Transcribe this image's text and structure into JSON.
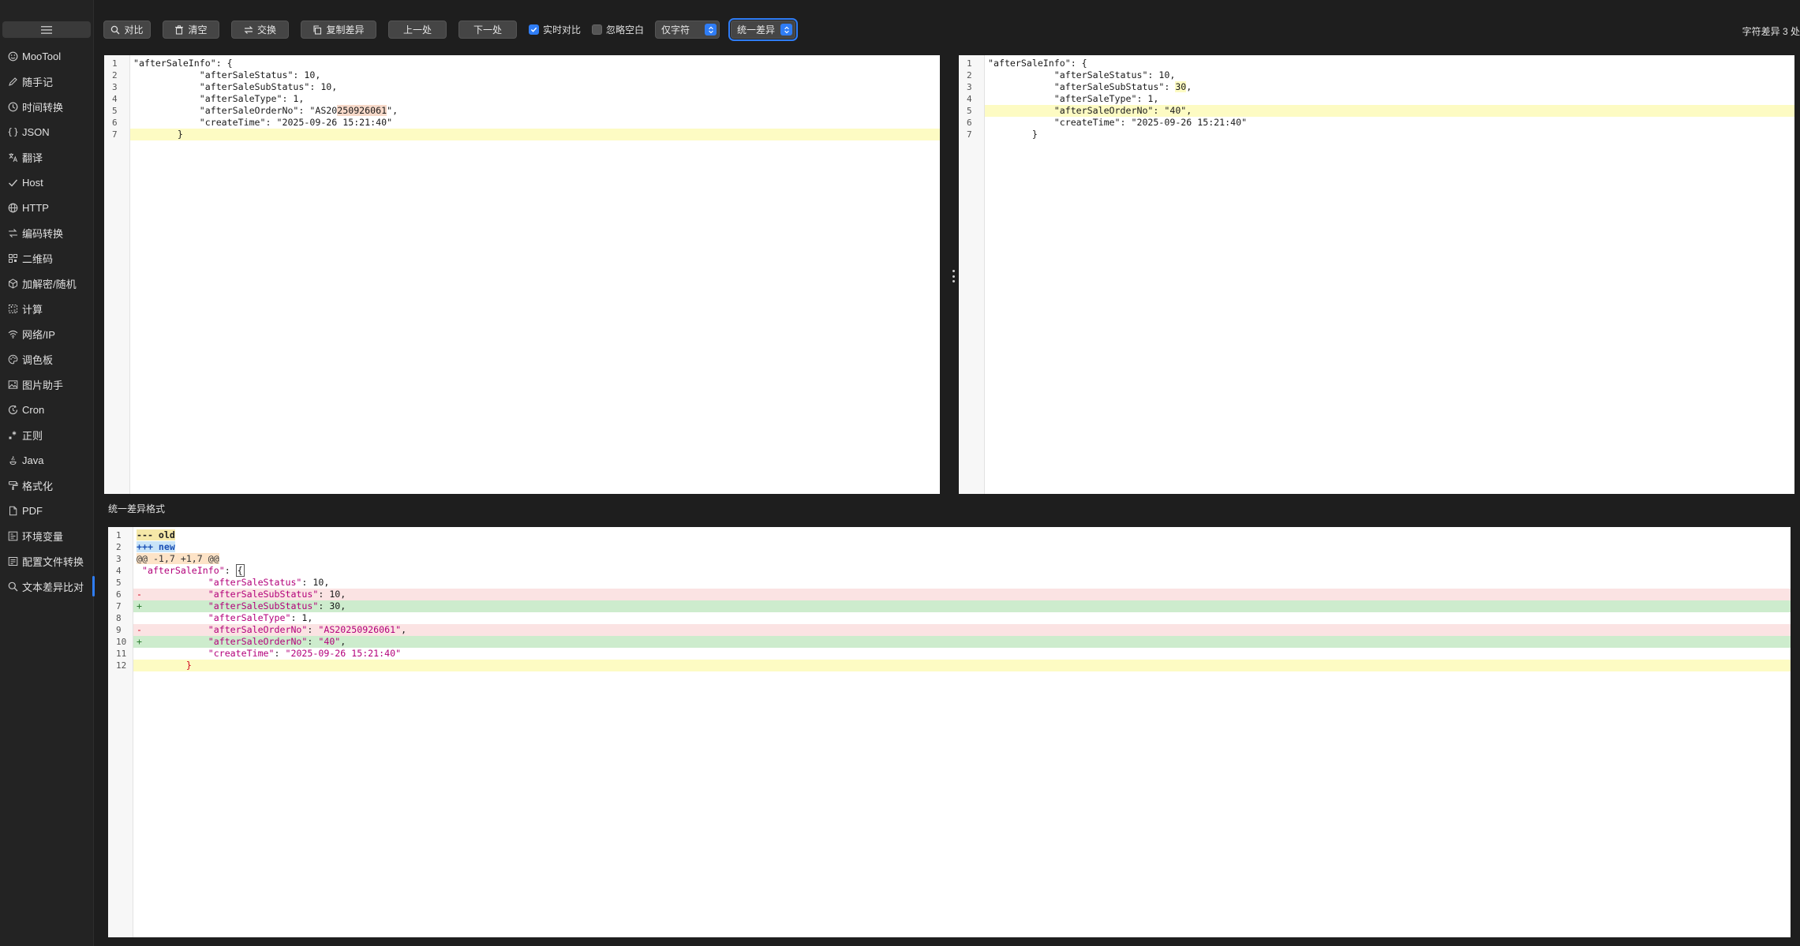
{
  "window": {
    "title": ""
  },
  "sidebar": {
    "items": [
      {
        "label": "MooTool",
        "icon": "smile-icon"
      },
      {
        "label": "随手记",
        "icon": "pen-icon"
      },
      {
        "label": "时间转换",
        "icon": "clock-icon"
      },
      {
        "label": "JSON",
        "icon": "braces-icon"
      },
      {
        "label": "翻译",
        "icon": "translate-icon"
      },
      {
        "label": "Host",
        "icon": "check-icon"
      },
      {
        "label": "HTTP",
        "icon": "globe-icon"
      },
      {
        "label": "编码转换",
        "icon": "swap-icon"
      },
      {
        "label": "二维码",
        "icon": "qrcode-icon"
      },
      {
        "label": "加解密/随机",
        "icon": "cube-icon"
      },
      {
        "label": "计算",
        "icon": "calc-icon"
      },
      {
        "label": "网络/IP",
        "icon": "wifi-icon"
      },
      {
        "label": "调色板",
        "icon": "palette-icon"
      },
      {
        "label": "图片助手",
        "icon": "image-icon"
      },
      {
        "label": "Cron",
        "icon": "cron-icon"
      },
      {
        "label": "正则",
        "icon": "regex-icon"
      },
      {
        "label": "Java",
        "icon": "java-icon"
      },
      {
        "label": "格式化",
        "icon": "paint-roller-icon"
      },
      {
        "label": "PDF",
        "icon": "pdf-icon"
      },
      {
        "label": "环境变量",
        "icon": "env-icon"
      },
      {
        "label": "配置文件转换",
        "icon": "config-icon"
      },
      {
        "label": "文本差异比对",
        "icon": "search-icon",
        "active": true
      }
    ]
  },
  "toolbar": {
    "compare": "对比",
    "clear": "清空",
    "swap": "交换",
    "copy_diff": "复制差异",
    "prev": "上一处",
    "next": "下一处",
    "realtime": {
      "label": "实时对比",
      "checked": true
    },
    "ignore_ws": {
      "label": "忽略空白",
      "checked": false
    },
    "granularity": "仅字符",
    "view_mode": "统一差异"
  },
  "status": {
    "text": "字符差异 3 处"
  },
  "left_editor": {
    "lines": [
      "\"afterSaleInfo\": {",
      "            \"afterSaleStatus\": 10,",
      "            \"afterSaleSubStatus\": 10,",
      "            \"afterSaleType\": 1,",
      "            \"afterSaleOrderNo\": \"AS20250926061\",",
      "            \"createTime\": \"2025-09-26 15:21:40\"",
      "        }"
    ]
  },
  "right_editor": {
    "lines": [
      "\"afterSaleInfo\": {",
      "            \"afterSaleStatus\": 10,",
      "            \"afterSaleSubStatus\": 30,",
      "            \"afterSaleType\": 1,",
      "            \"afterSaleOrderNo\": \"40\",",
      "            \"createTime\": \"2025-09-26 15:21:40\"",
      "        }"
    ]
  },
  "unified": {
    "title": "统一差异格式",
    "lines": [
      "--- old",
      "+++ new",
      "@@ -1,7 +1,7 @@",
      " \"afterSaleInfo\": {",
      "             \"afterSaleStatus\": 10,",
      "-            \"afterSaleSubStatus\": 10,",
      "+            \"afterSaleSubStatus\": 30,",
      "             \"afterSaleType\": 1,",
      "-            \"afterSaleOrderNo\": \"AS20250926061\",",
      "+            \"afterSaleOrderNo\": \"40\",",
      "             \"createTime\": \"2025-09-26 15:21:40\"",
      "         }"
    ]
  },
  "colors": {
    "accent": "#2f7df6",
    "line_highlight": "#fdfbc3",
    "deleted": "#fbe3e3",
    "added": "#cdeccd"
  }
}
